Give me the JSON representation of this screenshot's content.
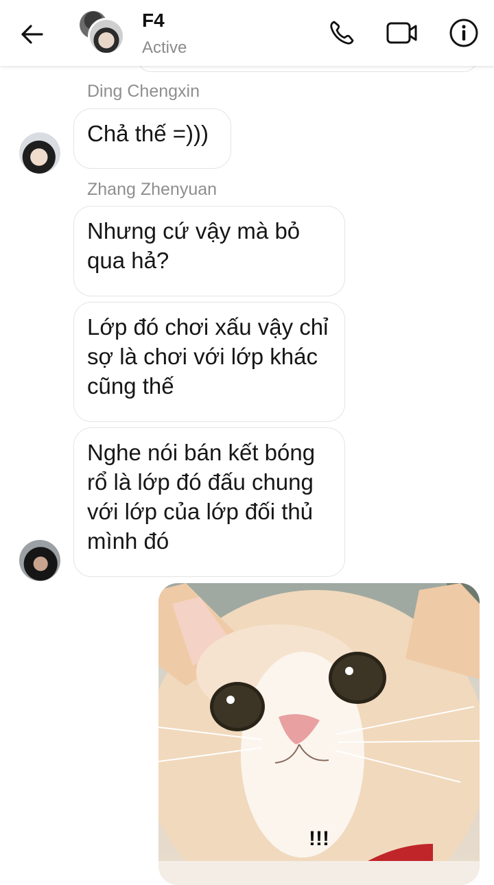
{
  "header": {
    "title": "F4",
    "status": "Active"
  },
  "icons": {
    "back": "arrow-left-icon",
    "phone": "phone-icon",
    "video": "video-camera-icon",
    "info": "info-icon"
  },
  "messages": [
    {
      "sender": "Ding Chengxin",
      "text": "Chả thế =)))"
    },
    {
      "sender": "Zhang Zhenyuan",
      "text": "Nhưng cứ vậy mà bỏ qua hả?"
    },
    {
      "sender": "Zhang Zhenyuan",
      "text": "Lớp đó chơi xấu vậy chỉ sợ là chơi với lớp khác cũng thế"
    },
    {
      "sender": "Zhang Zhenyuan",
      "text": "Nghe nói bán kết bóng rổ là lớp đó đấu chung với lớp của lớp đối thủ mình đó"
    }
  ],
  "sticker": {
    "caption": "!!!"
  },
  "colors": {
    "accent": "#111111",
    "muted": "#8a8a8a",
    "bubble_border": "#e4e4e4"
  }
}
